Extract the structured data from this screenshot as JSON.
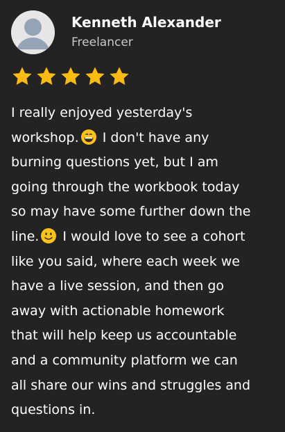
{
  "reviewer": {
    "name": "Kenneth Alexander",
    "title": "Freelancer",
    "avatar_icon": "user-avatar-placeholder-icon"
  },
  "rating": {
    "value": 5,
    "max": 5,
    "star_color": "#fbbb14",
    "icon": "star-icon"
  },
  "review": {
    "lines": [
      "I really enjoyed yesterday's",
      "workshop.",
      " I don't have any",
      "burning questions yet, but I am",
      "going through the workbook today",
      "so may have some further down the",
      "line.",
      " I would love to see a cohort",
      "like you said, where each week we",
      "have a live session, and then go",
      "away with actionable homework",
      "that will help keep us accountable",
      "and a community platform we can",
      "all share our wins and struggles and",
      "questions in."
    ],
    "emoji_1": "grinning-face-emoji",
    "emoji_2": "slightly-smiling-face-emoji"
  },
  "colors": {
    "background": "#232323",
    "text": "#ffffff",
    "subtext": "#c9c9c9"
  }
}
